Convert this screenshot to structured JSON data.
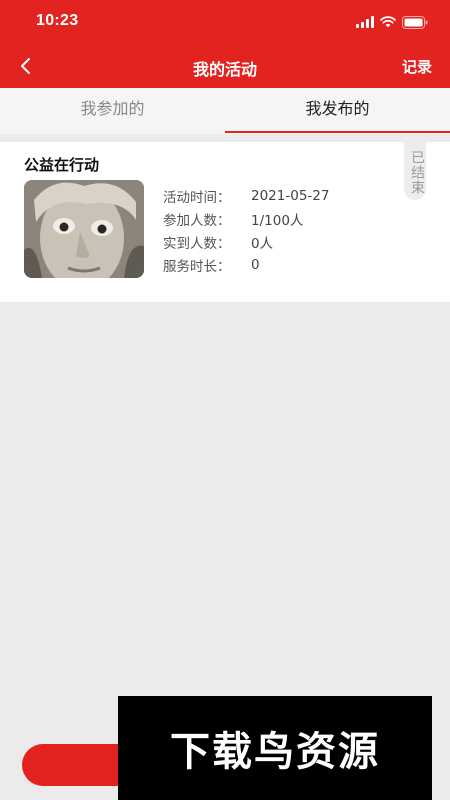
{
  "status_bar": {
    "time": "10:23"
  },
  "nav": {
    "title": "我的活动",
    "right_action": "记录"
  },
  "tabs": [
    {
      "label": "我参加的",
      "active": false
    },
    {
      "label": "我发布的",
      "active": true
    }
  ],
  "activity": {
    "title": "公益在行动",
    "status_badge": "已结束",
    "fields": [
      {
        "label": "活动时间：",
        "value": "2021-05-27"
      },
      {
        "label": "参加人数：",
        "value": "1/100人"
      },
      {
        "label": "实到人数：",
        "value": "0人"
      },
      {
        "label": "服务时长：",
        "value": "0"
      }
    ]
  },
  "watermark": {
    "text": "下载鸟资源"
  },
  "colors": {
    "brand": "#e3231f",
    "background": "#ebebeb"
  }
}
